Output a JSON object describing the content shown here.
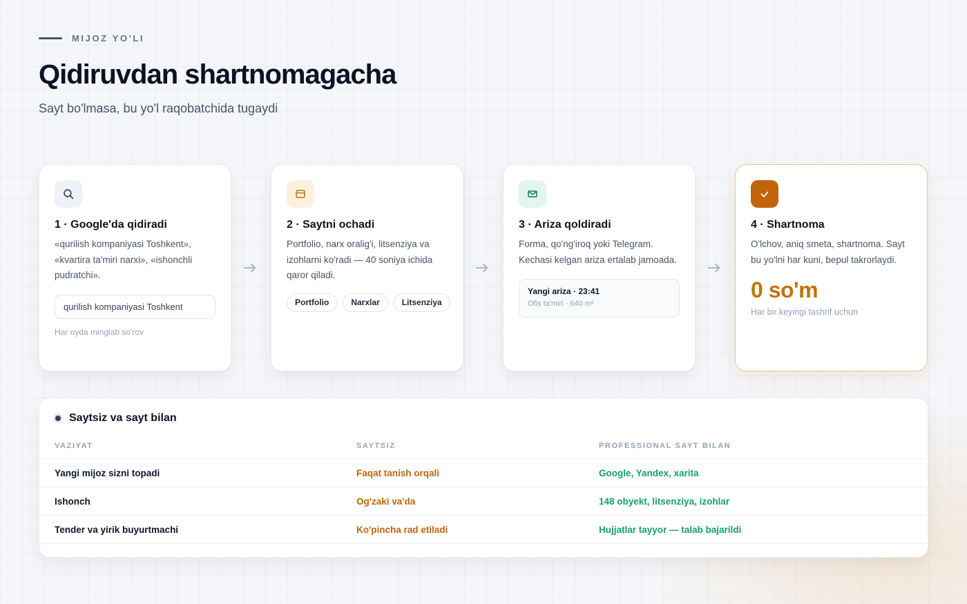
{
  "header": {
    "eyebrow": "MIJOZ YO'LI",
    "title": "Qidiruvdan shartnomagacha",
    "subtitle": "Sayt bo'lmasa, bu yo'l raqobatchida tugaydi"
  },
  "steps": [
    {
      "icon": "search-icon",
      "title": "1 · Google'da qidiradi",
      "description": "«qurilish kompaniyasi Toshkent», «kvartira ta'miri narxi», «ishonchli pudratchi».",
      "query": "qurilish kompaniyasi Toshkent",
      "note": "Har oyda minglab so'rov"
    },
    {
      "icon": "browser-window-icon",
      "title": "2 · Saytni ochadi",
      "description": "Portfolio, narx oralig'i, litsenziya va izohlarni ko'radi — 40 soniya ichida qaror qiladi.",
      "chips": [
        "Portfolio",
        "Narxlar",
        "Litsenziya"
      ]
    },
    {
      "icon": "envelope-icon",
      "title": "3 · Ariza qoldiradi",
      "description": "Forma, qo'ng'iroq yoki Telegram. Kechasi kelgan ariza ertalab jamoada.",
      "lead_title": "Yangi ariza · 23:41",
      "lead_sub": "Ofis ta'miri · 640 m²"
    },
    {
      "icon": "check-icon",
      "title": "4 · Shartnoma",
      "description": "O'lchov, aniq smeta, shartnoma. Sayt bu yo'lni har kuni, bepul takrorlaydi.",
      "price": "0 so'm",
      "price_note": "Har bir keyingi tashrif uchun"
    }
  ],
  "comparison": {
    "title": "Saytsiz va sayt bilan",
    "columns": [
      "VAZIYAT",
      "SAYTSIZ",
      "PROFESSIONAL SAYT BILAN"
    ],
    "rows": [
      [
        "Yangi mijoz sizni topadi",
        "Faqat tanish orqali",
        "Google, Yandex, xarita"
      ],
      [
        "Ishonch",
        "Og'zaki va'da",
        "148 obyekt, litsenziya, izohlar"
      ],
      [
        "Tender va yirik buyurtmachi",
        "Ko'pincha rad etiladi",
        "Hujjatlar tayyor — talab bajarildi"
      ]
    ]
  },
  "colors": {
    "accent": "#c2740b",
    "negative": "#c2650a",
    "positive": "#16a06b"
  }
}
